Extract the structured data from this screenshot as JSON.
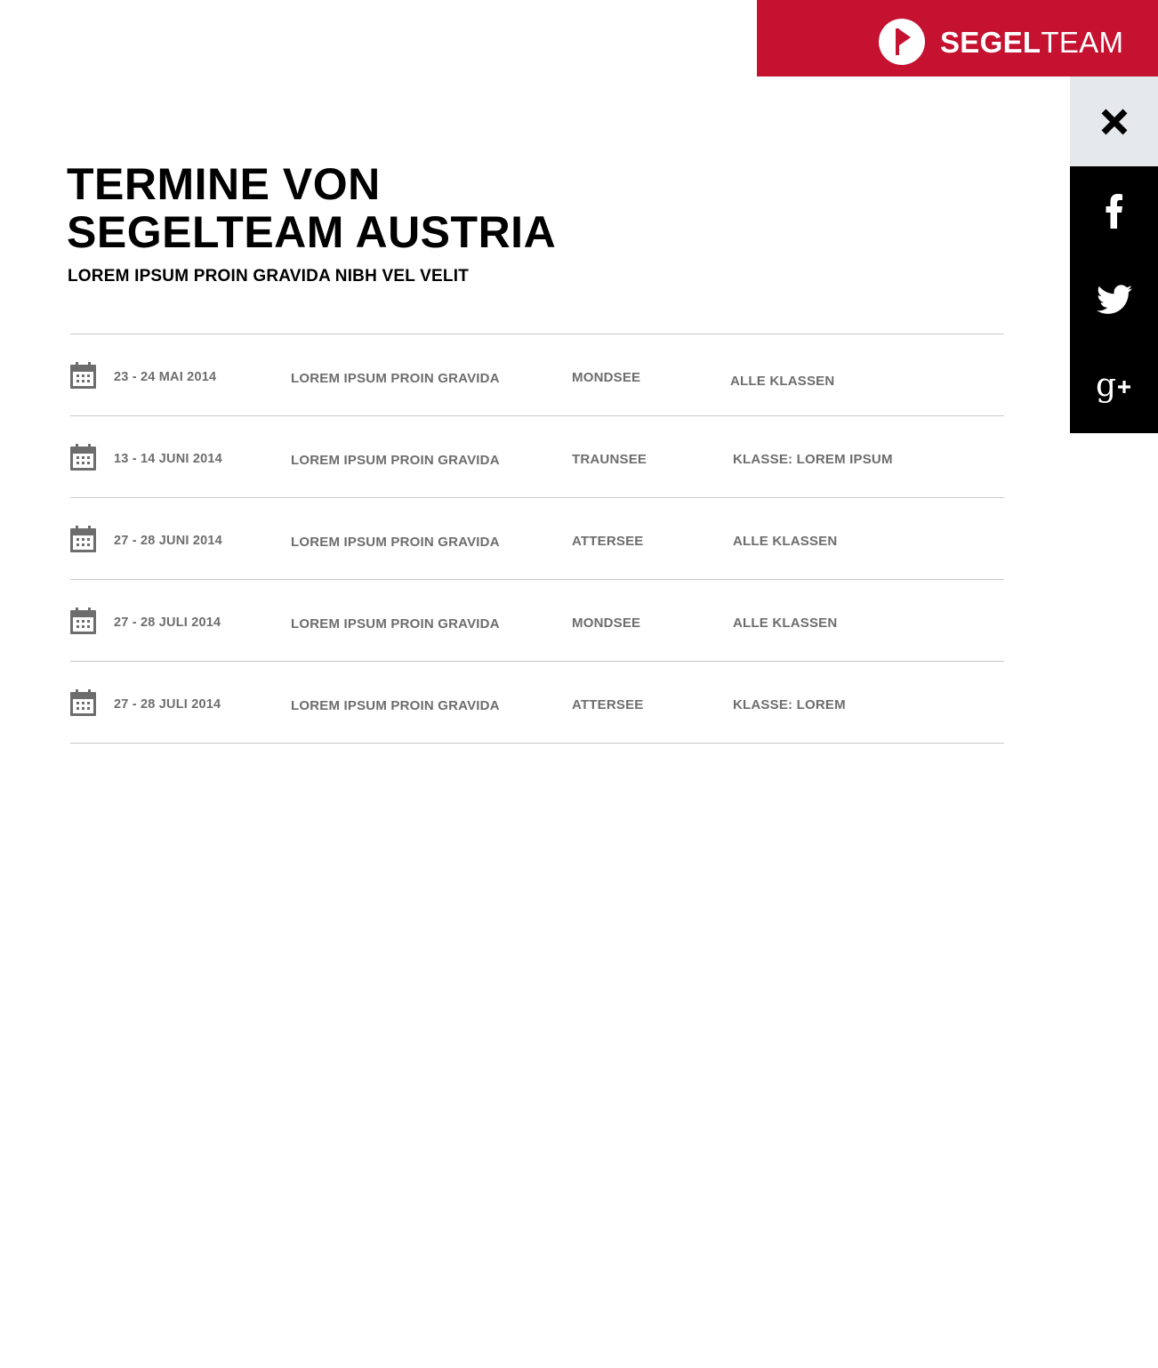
{
  "colors": {
    "brand": "#c41230",
    "close_bg": "#e6e9ec",
    "social_bg": "#000000",
    "row_text": "#6d6d6d",
    "divider": "#c9c9c9"
  },
  "brand": {
    "name_bold": "SEGEL",
    "name_light": "TEAM",
    "logo_icon": "flag-circle-icon"
  },
  "side_panel": {
    "close_icon": "close-icon",
    "social": [
      {
        "icon": "facebook-icon",
        "label": "f"
      },
      {
        "icon": "twitter-icon"
      },
      {
        "icon": "google-plus-icon",
        "label": "g+"
      }
    ]
  },
  "page": {
    "title_line1": "TERMINE VON",
    "title_line2": "SEGELTEAM AUSTRIA",
    "subtitle": "LOREM IPSUM PROIN GRAVIDA NIBH VEL VELIT"
  },
  "events": [
    {
      "date": "23 - 24 MAI 2014",
      "title": "LOREM IPSUM PROIN GRAVIDA",
      "location": "MONDSEE",
      "class": "ALLE KLASSEN"
    },
    {
      "date": "13 - 14 JUNI 2014",
      "title": "LOREM IPSUM PROIN GRAVIDA",
      "location": "TRAUNSEE",
      "class": "KLASSE: LOREM IPSUM"
    },
    {
      "date": "27 - 28 JUNI 2014",
      "title": "LOREM IPSUM PROIN GRAVIDA",
      "location": "ATTERSEE",
      "class": "ALLE KLASSEN"
    },
    {
      "date": "27 - 28 JULI 2014",
      "title": "LOREM IPSUM PROIN GRAVIDA",
      "location": "MONDSEE",
      "class": "ALLE KLASSEN"
    },
    {
      "date": "27 - 28 JULI 2014",
      "title": "LOREM IPSUM PROIN GRAVIDA",
      "location": "ATTERSEE",
      "class": "KLASSE: LOREM"
    }
  ]
}
